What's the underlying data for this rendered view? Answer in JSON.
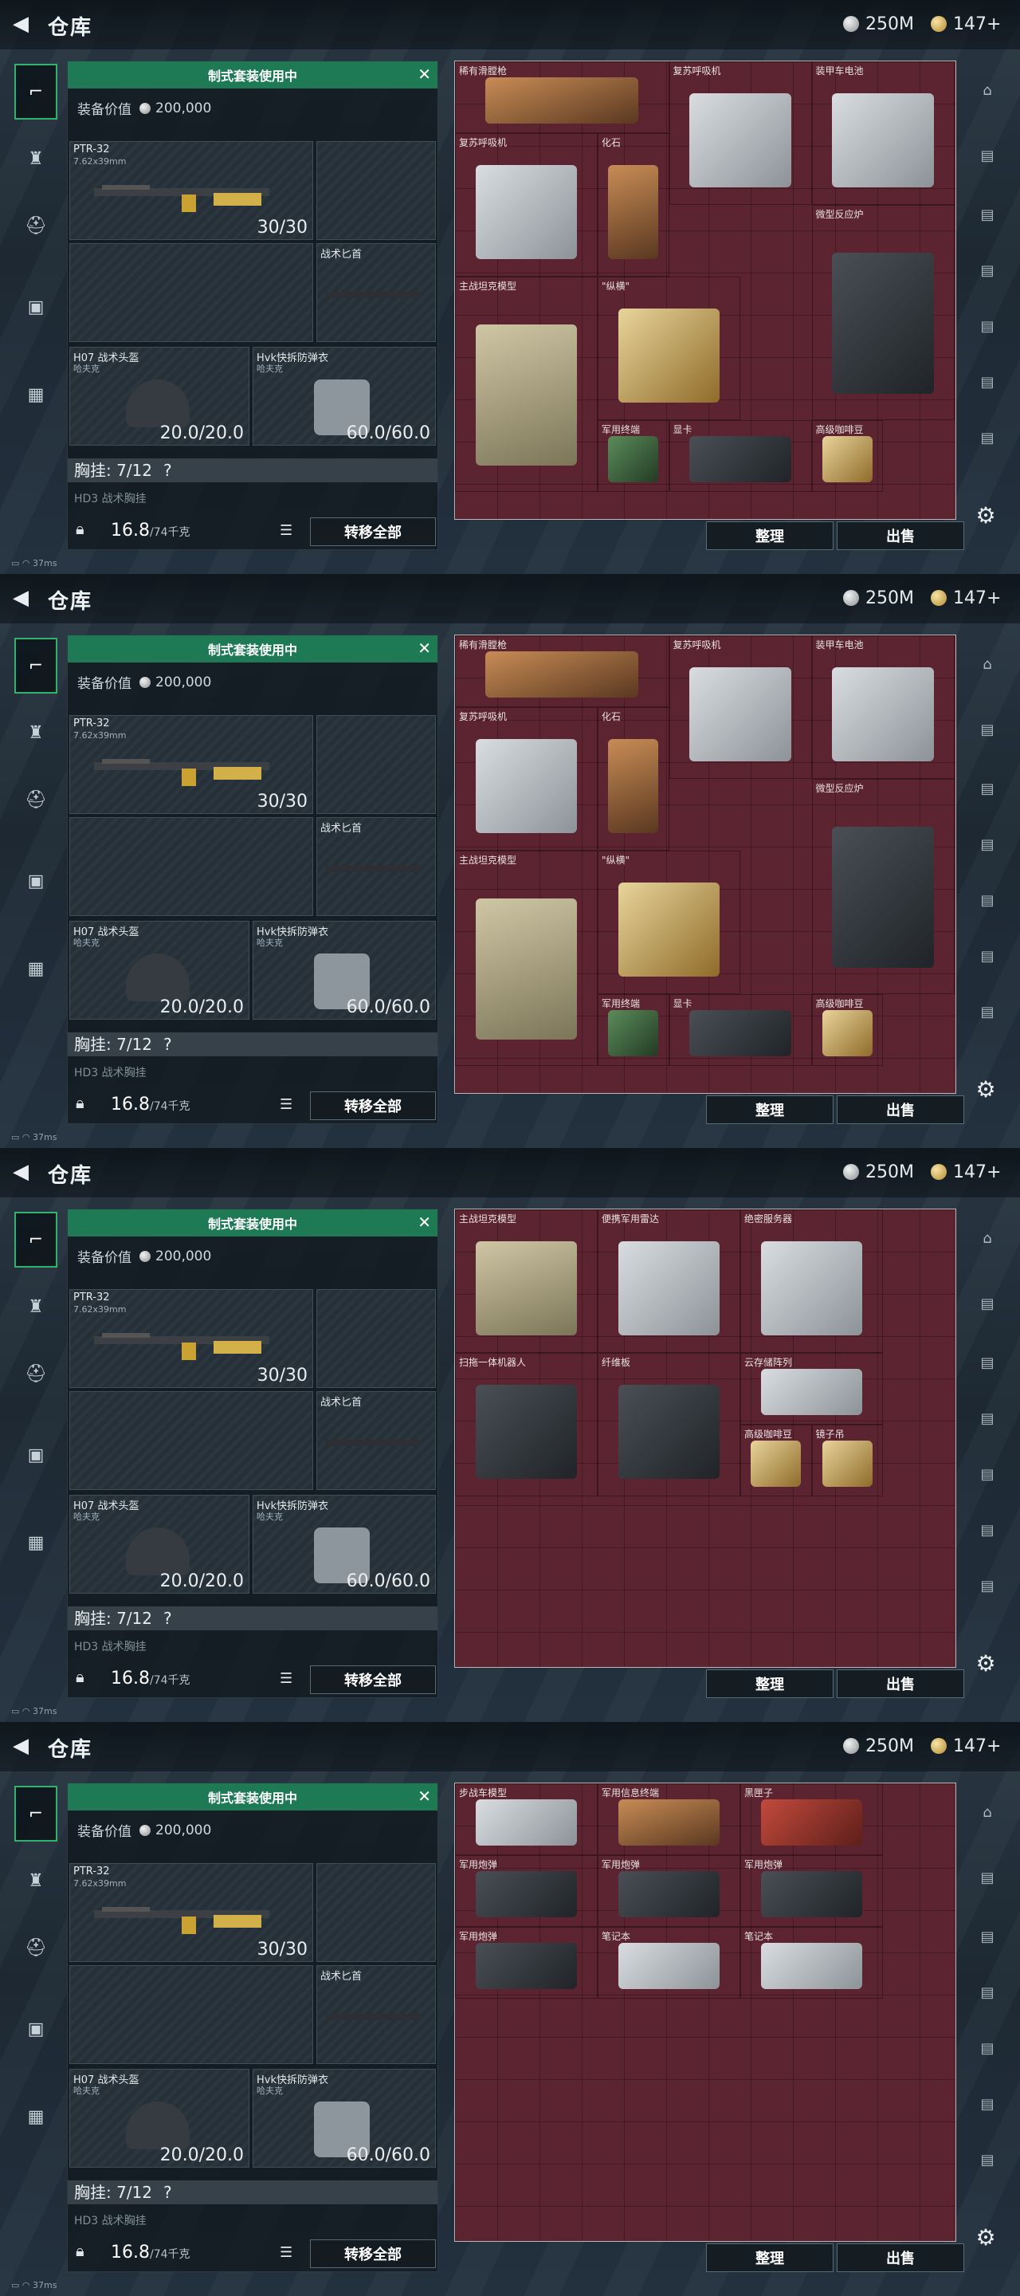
{
  "header": {
    "title": "仓库",
    "silver": "250M",
    "gold": "147+"
  },
  "loadout": {
    "header": "制式套装使用中",
    "value_label": "装备价值",
    "value": "200,000",
    "weapon": {
      "name": "PTR-32",
      "caliber": "7.62x39mm",
      "ammo": "30/30"
    },
    "knife": {
      "name": "战术匕首"
    },
    "helmet": {
      "name": "H07 战术头盔",
      "sub": "哈夫克",
      "durability": "20.0/20.0"
    },
    "armor": {
      "name": "Hvk快拆防弹衣",
      "sub": "哈夫克",
      "durability": "60.0/60.0"
    },
    "vest": "胸挂: 7/12",
    "vest_q": "?",
    "hd3": "HD3 战术胸挂",
    "weight": "16.8",
    "weight_max": "/74千克",
    "transfer": "转移全部"
  },
  "buttons": {
    "sort": "整理",
    "sell": "出售"
  },
  "status": {
    "ping": "37ms"
  },
  "pages": [
    {
      "items": [
        {
          "label": "稀有滑膛枪",
          "c": 0,
          "r": 0,
          "w": 3,
          "h": 1,
          "color": "brown"
        },
        {
          "label": "复苏呼吸机",
          "c": 3,
          "r": 0,
          "w": 2,
          "h": 2,
          "color": "gray"
        },
        {
          "label": "装甲车电池",
          "c": 5,
          "r": 0,
          "w": 2,
          "h": 2,
          "color": "gray"
        },
        {
          "label": "复苏呼吸机",
          "c": 0,
          "r": 1,
          "w": 2,
          "h": 2,
          "color": "gray"
        },
        {
          "label": "化石",
          "c": 2,
          "r": 1,
          "w": 1,
          "h": 2,
          "color": "brown"
        },
        {
          "label": "\"纵横\"",
          "c": 2,
          "r": 3,
          "w": 2,
          "h": 2,
          "color": "gold"
        },
        {
          "label": "微型反应炉",
          "c": 5,
          "r": 2,
          "w": 2,
          "h": 3,
          "color": "dark"
        },
        {
          "label": "主战坦克模型",
          "c": 0,
          "r": 3,
          "w": 2,
          "h": 3,
          "color": "tank"
        },
        {
          "label": "军用终端",
          "c": 2,
          "r": 5,
          "w": 1,
          "h": 1,
          "color": "green"
        },
        {
          "label": "显卡",
          "c": 3,
          "r": 5,
          "w": 2,
          "h": 1,
          "color": "dark"
        },
        {
          "label": "高级咖啡豆",
          "c": 5,
          "r": 5,
          "w": 1,
          "h": 1,
          "color": "gold"
        }
      ]
    },
    {
      "items": [
        {
          "label": "稀有滑膛枪",
          "c": 0,
          "r": 0,
          "w": 3,
          "h": 1,
          "color": "brown"
        },
        {
          "label": "复苏呼吸机",
          "c": 3,
          "r": 0,
          "w": 2,
          "h": 2,
          "color": "gray"
        },
        {
          "label": "装甲车电池",
          "c": 5,
          "r": 0,
          "w": 2,
          "h": 2,
          "color": "gray"
        },
        {
          "label": "复苏呼吸机",
          "c": 0,
          "r": 1,
          "w": 2,
          "h": 2,
          "color": "gray"
        },
        {
          "label": "化石",
          "c": 2,
          "r": 1,
          "w": 1,
          "h": 2,
          "color": "brown"
        },
        {
          "label": "\"纵横\"",
          "c": 2,
          "r": 3,
          "w": 2,
          "h": 2,
          "color": "gold"
        },
        {
          "label": "微型反应炉",
          "c": 5,
          "r": 2,
          "w": 2,
          "h": 3,
          "color": "dark"
        },
        {
          "label": "主战坦克模型",
          "c": 0,
          "r": 3,
          "w": 2,
          "h": 3,
          "color": "tank"
        },
        {
          "label": "军用终端",
          "c": 2,
          "r": 5,
          "w": 1,
          "h": 1,
          "color": "green"
        },
        {
          "label": "显卡",
          "c": 3,
          "r": 5,
          "w": 2,
          "h": 1,
          "color": "dark"
        },
        {
          "label": "高级咖啡豆",
          "c": 5,
          "r": 5,
          "w": 1,
          "h": 1,
          "color": "gold"
        }
      ]
    },
    {
      "items": [
        {
          "label": "主战坦克模型",
          "c": 0,
          "r": 0,
          "w": 2,
          "h": 2,
          "color": "tank"
        },
        {
          "label": "便携军用雷达",
          "c": 2,
          "r": 0,
          "w": 2,
          "h": 2,
          "color": "gray"
        },
        {
          "label": "绝密服务器",
          "c": 4,
          "r": 0,
          "w": 2,
          "h": 2,
          "color": "gray"
        },
        {
          "label": "扫拖一体机器人",
          "c": 0,
          "r": 2,
          "w": 2,
          "h": 2,
          "color": "dark"
        },
        {
          "label": "纤维板",
          "c": 2,
          "r": 2,
          "w": 2,
          "h": 2,
          "color": "dark"
        },
        {
          "label": "云存储阵列",
          "c": 4,
          "r": 2,
          "w": 2,
          "h": 1,
          "color": "gray"
        },
        {
          "label": "高级咖啡豆",
          "c": 4,
          "r": 3,
          "w": 1,
          "h": 1,
          "color": "gold"
        },
        {
          "label": "镜子吊",
          "c": 5,
          "r": 3,
          "w": 1,
          "h": 1,
          "color": "gold"
        }
      ]
    },
    {
      "items": [
        {
          "label": "步战车模型",
          "c": 0,
          "r": 0,
          "w": 2,
          "h": 1,
          "color": "gray"
        },
        {
          "label": "军用信息终端",
          "c": 2,
          "r": 0,
          "w": 2,
          "h": 1,
          "color": "brown"
        },
        {
          "label": "黑匣子",
          "c": 4,
          "r": 0,
          "w": 2,
          "h": 1,
          "color": "red"
        },
        {
          "label": "军用炮弹",
          "c": 0,
          "r": 1,
          "w": 2,
          "h": 1,
          "color": "dark"
        },
        {
          "label": "军用炮弹",
          "c": 2,
          "r": 1,
          "w": 2,
          "h": 1,
          "color": "dark"
        },
        {
          "label": "军用炮弹",
          "c": 4,
          "r": 1,
          "w": 2,
          "h": 1,
          "color": "dark"
        },
        {
          "label": "军用炮弹",
          "c": 0,
          "r": 2,
          "w": 2,
          "h": 1,
          "color": "dark"
        },
        {
          "label": "笔记本",
          "c": 2,
          "r": 2,
          "w": 2,
          "h": 1,
          "color": "gray"
        },
        {
          "label": "笔记本",
          "c": 4,
          "r": 2,
          "w": 2,
          "h": 1,
          "color": "gray"
        }
      ]
    }
  ]
}
